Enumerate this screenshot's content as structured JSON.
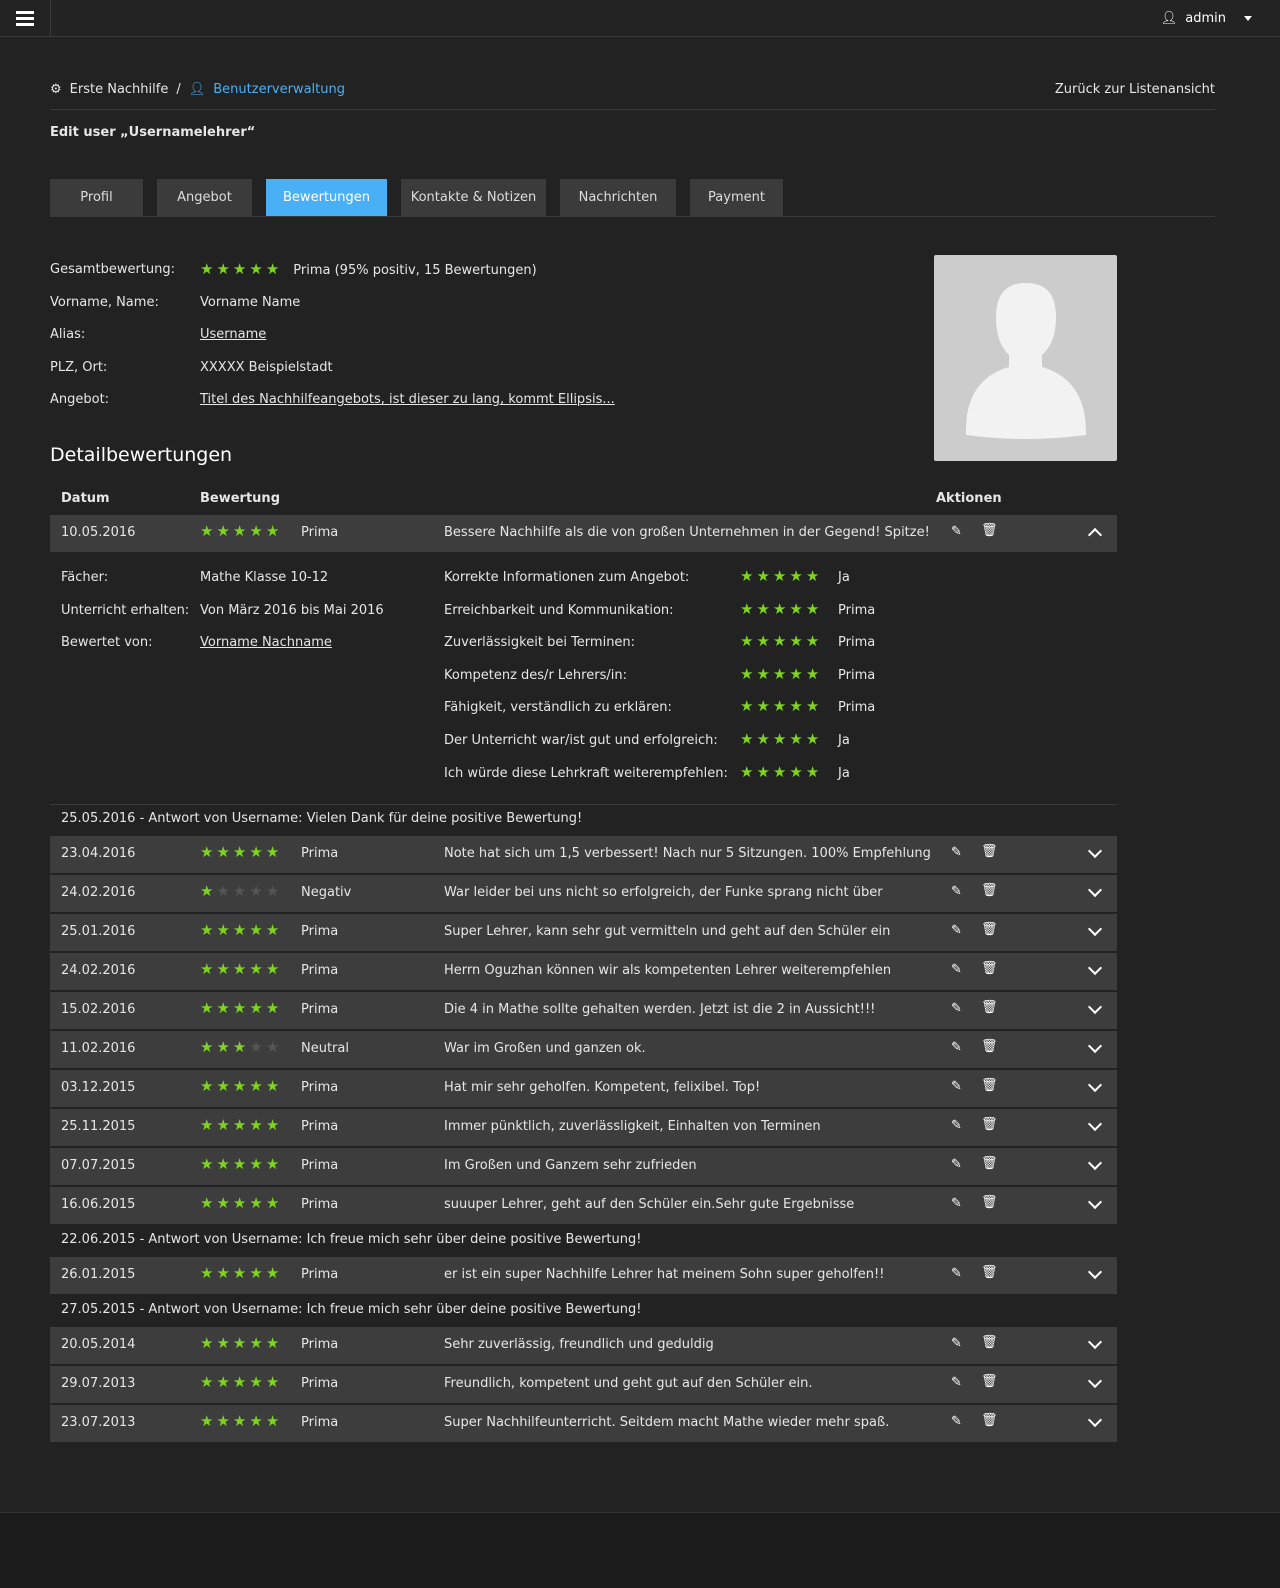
{
  "topbar": {
    "user": "admin"
  },
  "breadcrumb": {
    "root": "Erste Nachhilfe",
    "sep": "/",
    "current": "Benutzerverwaltung"
  },
  "back_link": "Zurück zur Listenansicht",
  "page_title": "Edit user „Usernamelehrer“",
  "tabs": [
    "Profil",
    "Angebot",
    "Bewertungen",
    "Kontakte & Notizen",
    "Nachrichten",
    "Payment"
  ],
  "active_tab": 2,
  "info": [
    {
      "label": "Gesamtbewertung:",
      "value": "Prima (95% positiv, 15 Bewertungen)",
      "stars": 5
    },
    {
      "label": "Vorname, Name:",
      "value": "Vorname Name"
    },
    {
      "label": "Alias:",
      "value": "Username",
      "link": true
    },
    {
      "label": "PLZ, Ort:",
      "value": "XXXXX Beispielstadt"
    },
    {
      "label": "Angebot:",
      "value": "Titel des Nachhilfeangebots, ist dieser zu lang, kommt Ellipsis...",
      "link": true
    }
  ],
  "section_title": "Detailbewertungen",
  "table_headers": {
    "date": "Datum",
    "rating": "Bewertung",
    "actions": "Aktionen"
  },
  "details": {
    "left": [
      {
        "label": "Fächer:",
        "value": "Mathe Klasse 10-12"
      },
      {
        "label": "Unterricht erhalten:",
        "value": "Von März 2016 bis Mai 2016"
      },
      {
        "label": "Bewertet von:",
        "value": "Vorname Nachname",
        "link": true
      }
    ],
    "criteria": [
      {
        "label": "Korrekte Informationen zum Angebot:",
        "stars": 5,
        "value": "Ja"
      },
      {
        "label": "Erreichbarkeit und Kommunikation:",
        "stars": 5,
        "value": "Prima"
      },
      {
        "label": "Zuverlässigkeit bei Terminen:",
        "stars": 5,
        "value": "Prima"
      },
      {
        "label": "Kompetenz des/r Lehrers/in:",
        "stars": 5,
        "value": "Prima"
      },
      {
        "label": "Fähigkeit, verständlich zu erklären:",
        "stars": 5,
        "value": "Prima"
      },
      {
        "label": "Der Unterricht war/ist gut und erfolgreich:",
        "stars": 5,
        "value": "Ja"
      },
      {
        "label": "Ich würde diese Lehrkraft weiterempfehlen:",
        "stars": 5,
        "value": "Ja"
      }
    ]
  },
  "reviews": [
    {
      "date": "10.05.2016",
      "stars": 5,
      "label": "Prima",
      "comment": "Bessere Nachhilfe als die von großen Unternehmen in der Gegend! Spitze!",
      "expanded": true
    },
    {
      "answer": "25.05.2016 - Antwort von Username: Vielen Dank für deine positive Bewertung!"
    },
    {
      "date": "23.04.2016",
      "stars": 5,
      "label": "Prima",
      "comment": "Note hat sich um 1,5 verbessert! Nach nur 5 Sitzungen. 100% Empfehlung"
    },
    {
      "date": "24.02.2016",
      "stars": 1,
      "label": "Negativ",
      "comment": "War leider bei uns nicht so erfolgreich, der Funke sprang nicht über"
    },
    {
      "date": "25.01.2016",
      "stars": 5,
      "label": "Prima",
      "comment": "Super Lehrer, kann sehr gut vermitteln und geht auf den Schüler ein"
    },
    {
      "date": "24.02.2016",
      "stars": 5,
      "label": "Prima",
      "comment": "Herrn Oguzhan können wir als kompetenten Lehrer weiterempfehlen"
    },
    {
      "date": "15.02.2016",
      "stars": 5,
      "label": "Prima",
      "comment": "Die 4 in Mathe sollte gehalten werden. Jetzt ist die 2 in Aussicht!!!"
    },
    {
      "date": "11.02.2016",
      "stars": 3,
      "label": "Neutral",
      "comment": "War im Großen und ganzen ok."
    },
    {
      "date": "03.12.2015",
      "stars": 5,
      "label": "Prima",
      "comment": "Hat mir sehr geholfen. Kompetent, felixibel. Top!"
    },
    {
      "date": "25.11.2015",
      "stars": 5,
      "label": "Prima",
      "comment": "Immer pünktlich, zuverlässligkeit, Einhalten von Terminen"
    },
    {
      "date": "07.07.2015",
      "stars": 5,
      "label": "Prima",
      "comment": "Im Großen und Ganzem sehr zufrieden"
    },
    {
      "date": "16.06.2015",
      "stars": 5,
      "label": "Prima",
      "comment": "suuuper Lehrer, geht auf den Schüler ein.Sehr gute Ergebnisse"
    },
    {
      "answer": "22.06.2015 - Antwort von Username: Ich freue mich sehr über deine positive Bewertung!"
    },
    {
      "date": "26.01.2015",
      "stars": 5,
      "label": "Prima",
      "comment": "er ist ein super Nachhilfe Lehrer hat meinem Sohn super geholfen!!"
    },
    {
      "answer": "27.05.2015 - Antwort von Username: Ich freue mich sehr über deine positive Bewertung!"
    },
    {
      "date": "20.05.2014",
      "stars": 5,
      "label": "Prima",
      "comment": "Sehr zuverlässig, freundlich und geduldig"
    },
    {
      "date": "29.07.2013",
      "stars": 5,
      "label": "Prima",
      "comment": "Freundlich, kompetent und geht gut auf den Schüler ein."
    },
    {
      "date": "23.07.2013",
      "stars": 5,
      "label": "Prima",
      "comment": "Super Nachhilfeunterricht. Seitdem macht Mathe wieder mehr spaß."
    }
  ],
  "colors": {
    "accent": "#4ab0f5",
    "star": "#7ed321",
    "row": "#3d3d3d",
    "bg": "#222222"
  }
}
